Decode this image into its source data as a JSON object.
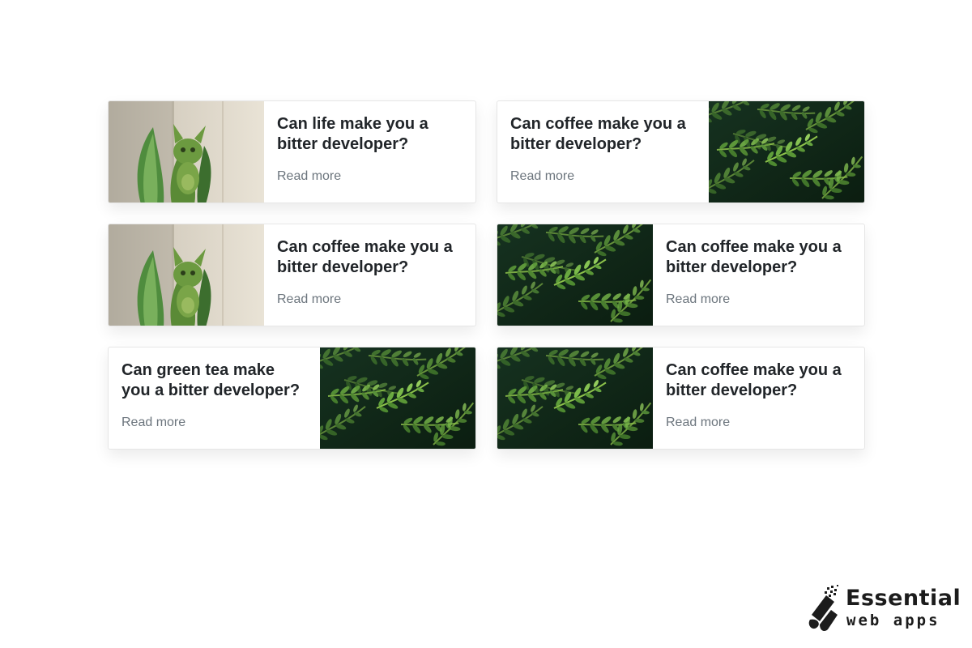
{
  "cards": [
    {
      "title": "Can life make you a bitter developer?",
      "link": "Read more",
      "image": "frog-statue-photo"
    },
    {
      "title": "Can coffee make you a bitter developer?",
      "link": "Read more",
      "image": "fern-leaves-photo"
    },
    {
      "title": "Can coffee make you a bitter developer?",
      "link": "Read more",
      "image": "frog-statue-photo"
    },
    {
      "title": "Can coffee make you a bitter developer?",
      "link": "Read more",
      "image": "fern-leaves-photo"
    },
    {
      "title": "Can green tea make you a bitter developer?",
      "link": "Read more",
      "image": "fern-leaves-photo"
    },
    {
      "title": "Can coffee make you a bitter developer?",
      "link": "Read more",
      "image": "fern-leaves-photo"
    }
  ],
  "brand": {
    "line1": "Essential",
    "line2": "web apps",
    "icon": "essential-web-apps-logo-icon"
  },
  "colors": {
    "title": "#212529",
    "link": "#6c757d",
    "fern_dark": "#0f2414",
    "fern_light": "#5f9e3a"
  }
}
